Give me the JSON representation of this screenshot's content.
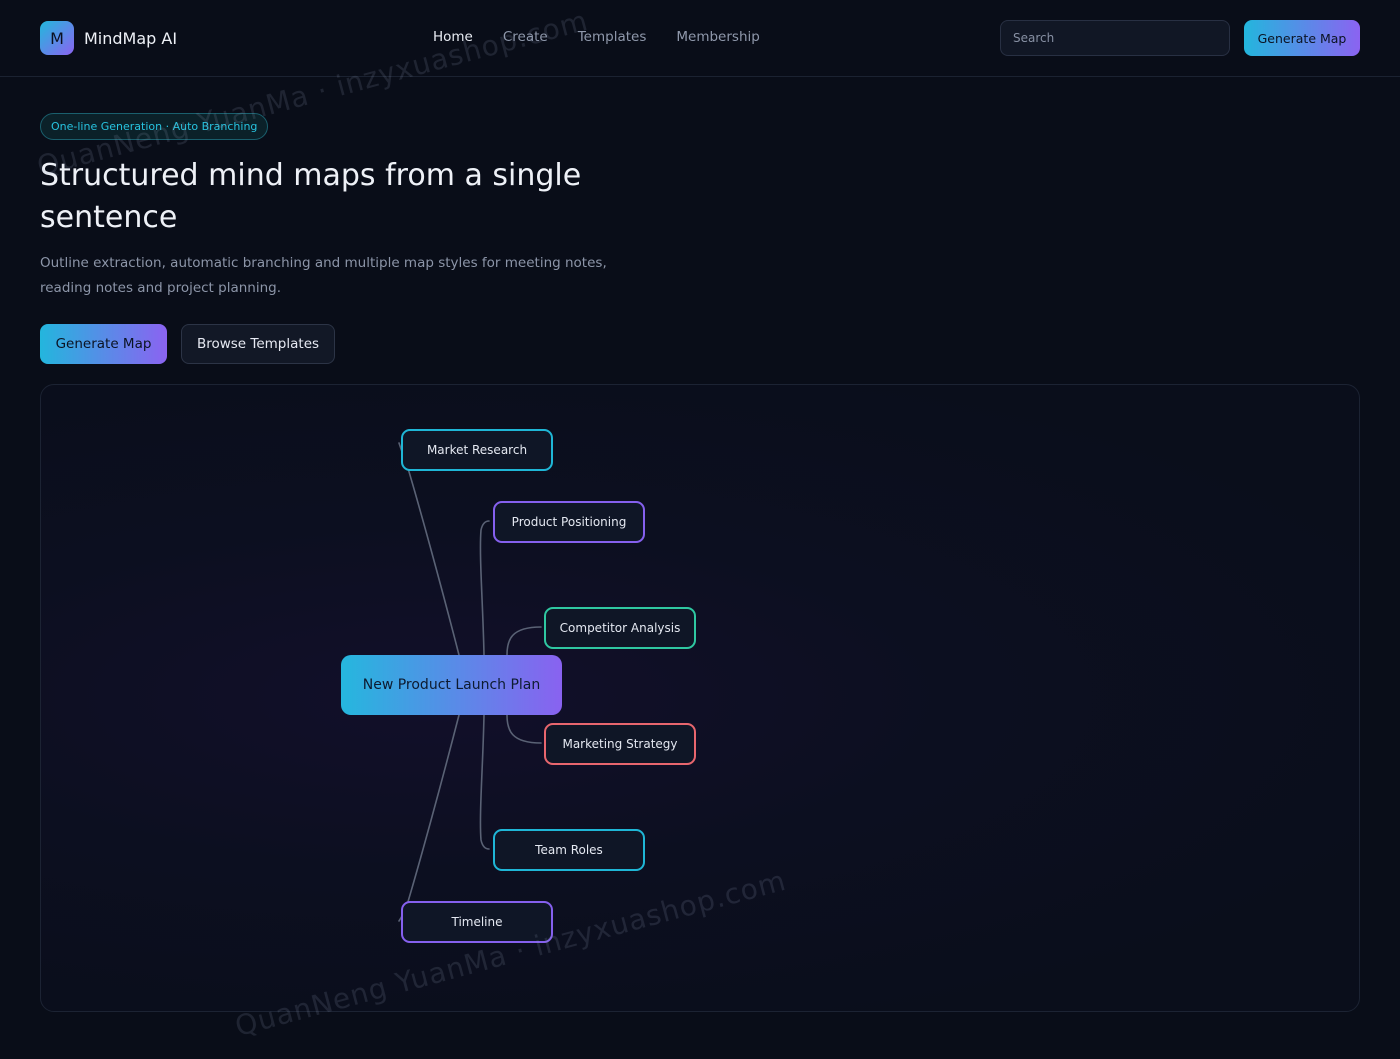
{
  "header": {
    "logo_letter": "M",
    "app_name": "MindMap AI",
    "nav": [
      "Home",
      "Create",
      "Templates",
      "Membership"
    ],
    "search_placeholder": "Search",
    "cta_label": "Generate Map"
  },
  "hero": {
    "badge": "One-line Generation · Auto Branching",
    "title": "Structured mind maps from a single sentence",
    "subtitle": "Outline extraction, automatic branching and multiple map styles for meeting notes, reading notes and project planning.",
    "primary_button": "Generate Map",
    "secondary_button": "Browse Templates"
  },
  "mindmap": {
    "root": "New Product Launch Plan",
    "branches": [
      {
        "label": "Market Research",
        "color": "#1fb6d6"
      },
      {
        "label": "Product Positioning",
        "color": "#8560ee"
      },
      {
        "label": "Competitor Analysis",
        "color": "#2fc7a1"
      },
      {
        "label": "Marketing Strategy",
        "color": "#e8666e"
      },
      {
        "label": "Team Roles",
        "color": "#1fb6d6"
      },
      {
        "label": "Timeline",
        "color": "#8560ee"
      }
    ]
  },
  "watermark": "QuanNeng YuanMa · inzyxuashop.com",
  "colors": {
    "background": "#090d18",
    "accent_start": "#23b6dd",
    "accent_end": "#8b63f1"
  }
}
